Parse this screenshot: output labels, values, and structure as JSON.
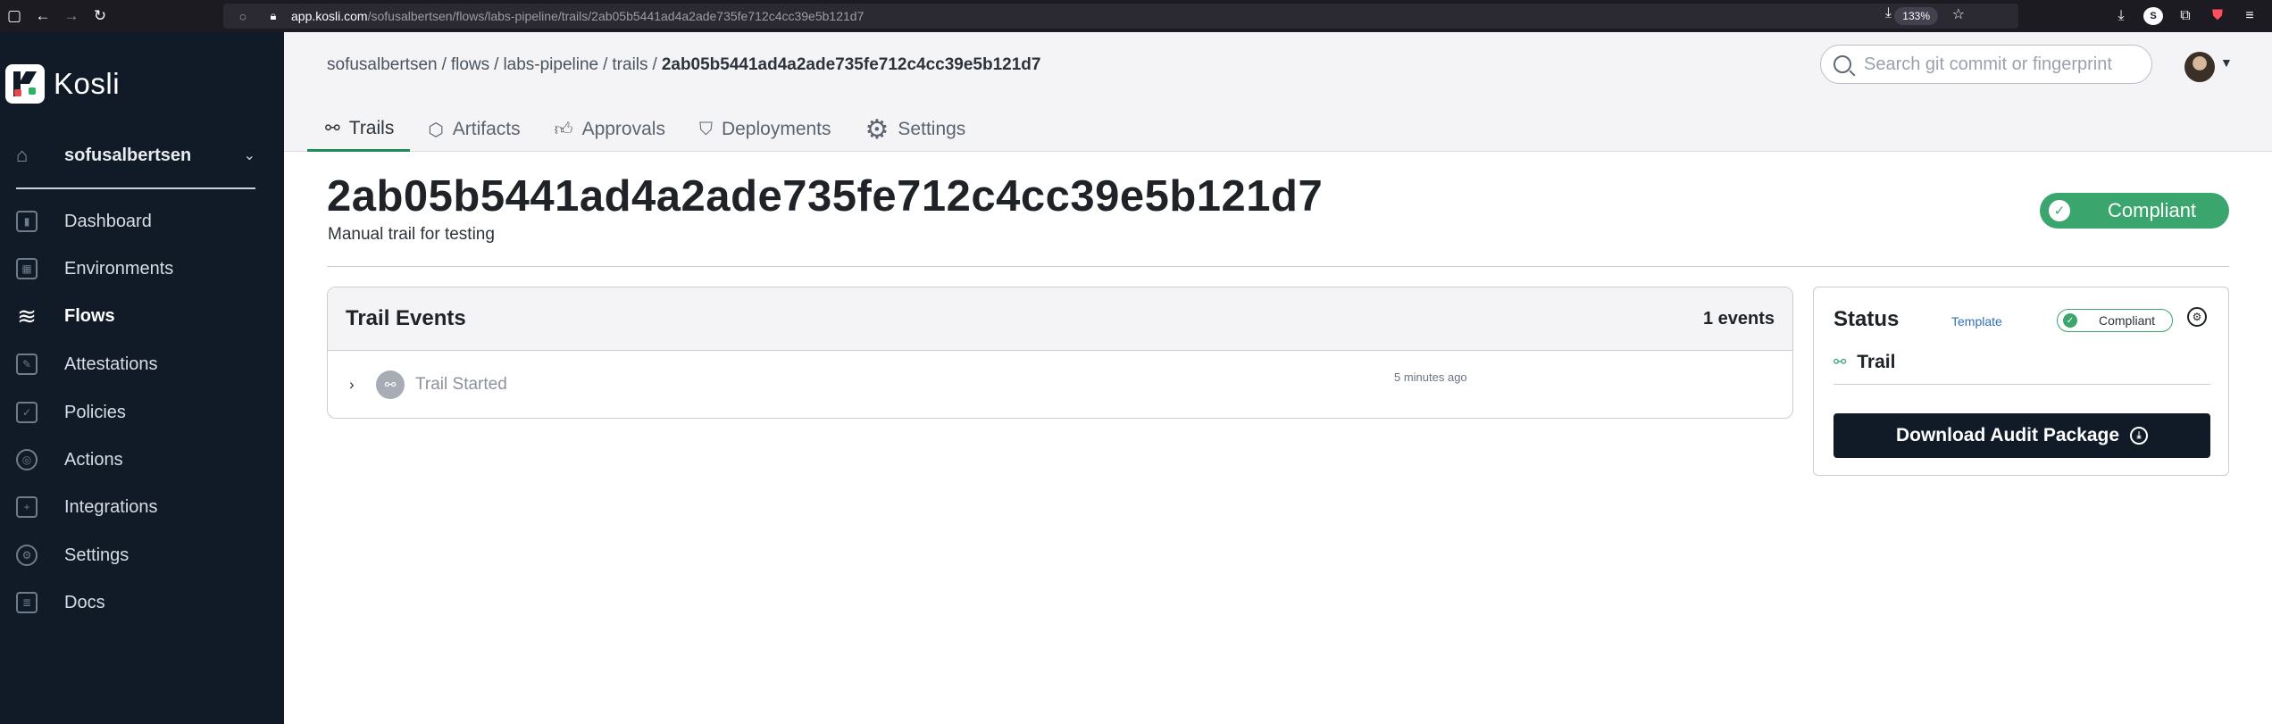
{
  "browser": {
    "url_domain": "app.kosli.com",
    "url_path": "/sofusalbertsen/flows/labs-pipeline/trails/2ab05b5441ad4a2ade735fe712c4cc39e5b121d7",
    "zoom": "133%"
  },
  "sidebar": {
    "brand": "Kosli",
    "org_name": "sofusalbertsen",
    "items": [
      {
        "label": "Dashboard",
        "icon": "dashboard-icon"
      },
      {
        "label": "Environments",
        "icon": "environments-icon"
      },
      {
        "label": "Flows",
        "icon": "flows-icon"
      },
      {
        "label": "Attestations",
        "icon": "attestations-icon"
      },
      {
        "label": "Policies",
        "icon": "policies-icon"
      },
      {
        "label": "Actions",
        "icon": "actions-icon"
      },
      {
        "label": "Integrations",
        "icon": "integrations-icon"
      },
      {
        "label": "Settings",
        "icon": "settings-icon"
      },
      {
        "label": "Docs",
        "icon": "docs-icon"
      }
    ],
    "active": "Flows"
  },
  "header": {
    "breadcrumb": [
      "sofusalbertsen",
      "flows",
      "labs-pipeline",
      "trails"
    ],
    "breadcrumb_current": "2ab05b5441ad4a2ade735fe712c4cc39e5b121d7",
    "search_placeholder": "Search git commit or fingerprint",
    "tabs": [
      {
        "label": "Trails",
        "icon": "trails-icon"
      },
      {
        "label": "Artifacts",
        "icon": "artifacts-icon"
      },
      {
        "label": "Approvals",
        "icon": "approvals-icon"
      },
      {
        "label": "Deployments",
        "icon": "deployments-icon"
      },
      {
        "label": "Settings",
        "icon": "gear-icon"
      }
    ],
    "active_tab": "Trails"
  },
  "page": {
    "title": "2ab05b5441ad4a2ade735fe712c4cc39e5b121d7",
    "subtitle": "Manual trail for testing",
    "compliance": "Compliant"
  },
  "events": {
    "title": "Trail Events",
    "count": "1 events",
    "rows": [
      {
        "label": "Trail Started",
        "time": "5 minutes ago"
      }
    ]
  },
  "status": {
    "title": "Status",
    "template_link": "Template",
    "badge": "Compliant",
    "trail_label": "Trail",
    "download_label": "Download Audit Package"
  },
  "colors": {
    "sidebar_bg": "#111b27",
    "compliant_green": "#3aa56c",
    "active_tab_underline": "#1f8a5a"
  }
}
